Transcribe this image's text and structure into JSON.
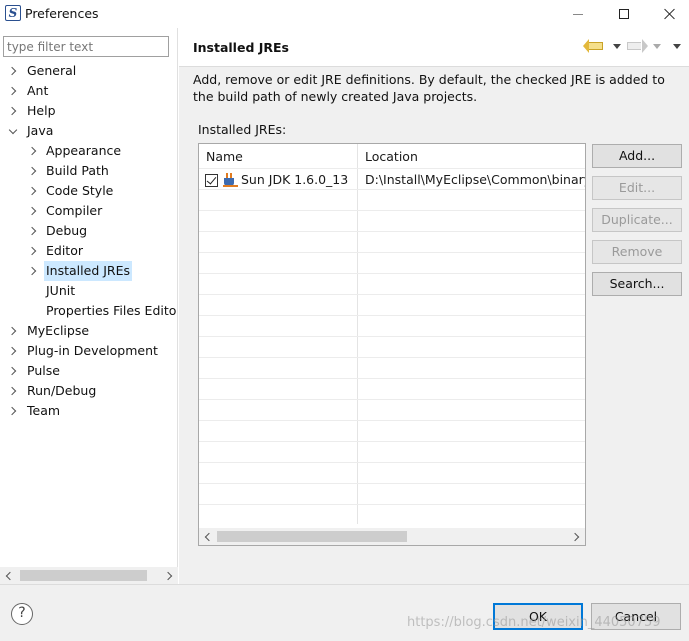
{
  "window": {
    "title": "Preferences"
  },
  "filter": {
    "placeholder": "type filter text"
  },
  "tree": {
    "general": "General",
    "ant": "Ant",
    "help": "Help",
    "java": "Java",
    "appearance": "Appearance",
    "build_path": "Build Path",
    "code_style": "Code Style",
    "compiler": "Compiler",
    "debug": "Debug",
    "editor": "Editor",
    "installed_jres": "Installed JREs",
    "junit": "JUnit",
    "properties_files_editor": "Properties Files Edito",
    "myeclipse": "MyEclipse",
    "plugin_development": "Plug-in Development",
    "pulse": "Pulse",
    "run_debug": "Run/Debug",
    "team": "Team"
  },
  "page": {
    "title": "Installed JREs",
    "description": "Add, remove or edit JRE definitions. By default, the checked JRE is added to the build path of newly created Java projects.",
    "list_label": "Installed JREs:"
  },
  "table": {
    "columns": [
      "Name",
      "Location"
    ],
    "rows": [
      {
        "name": "Sun JDK 1.6.0_13",
        "location": "D:\\Install\\MyEclipse\\Common\\binary\\c",
        "checked": true
      }
    ]
  },
  "buttons": {
    "add": "Add...",
    "edit": "Edit...",
    "duplicate": "Duplicate...",
    "remove": "Remove",
    "search": "Search...",
    "ok": "OK",
    "cancel": "Cancel"
  },
  "help_symbol": "?",
  "watermark": "https://blog.csdn.net/weixin_44050759",
  "icons": {
    "back": "back-arrow-icon",
    "forward": "forward-arrow-icon",
    "help": "help-icon",
    "jre": "jre-icon"
  },
  "colors": {
    "selection": "#cce8ff",
    "default_button_border": "#0078d7"
  }
}
